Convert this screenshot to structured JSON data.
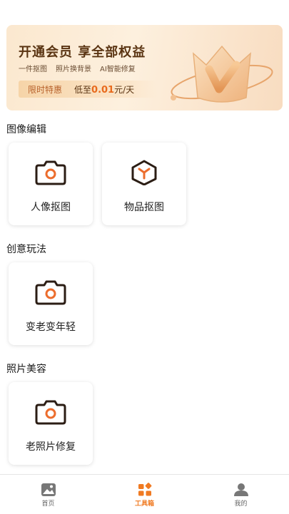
{
  "banner": {
    "title": "开通会员 享全部权益",
    "features": [
      "一件抠图",
      "照片换背景",
      "AI智能修复"
    ],
    "promo_tag": "限时特惠",
    "promo_prefix": "低至",
    "promo_price": "0.01",
    "promo_suffix": "元/天"
  },
  "sections": [
    {
      "title": "图像编辑",
      "tools": [
        {
          "label": "人像抠图",
          "icon": "camera-icon"
        },
        {
          "label": "物品抠图",
          "icon": "cube-icon"
        }
      ]
    },
    {
      "title": "创意玩法",
      "tools": [
        {
          "label": "变老变年轻",
          "icon": "camera-icon"
        }
      ]
    },
    {
      "title": "照片美容",
      "tools": [
        {
          "label": "老照片修复",
          "icon": "camera-icon"
        }
      ]
    }
  ],
  "nav": {
    "items": [
      {
        "label": "首页",
        "icon": "image-icon"
      },
      {
        "label": "工具箱",
        "icon": "toolbox-icon"
      },
      {
        "label": "我的",
        "icon": "profile-icon"
      }
    ],
    "active_index": 1
  },
  "colors": {
    "accent": "#f07a22",
    "icon_dark": "#2b1d14",
    "icon_accent": "#ec6d2d"
  }
}
